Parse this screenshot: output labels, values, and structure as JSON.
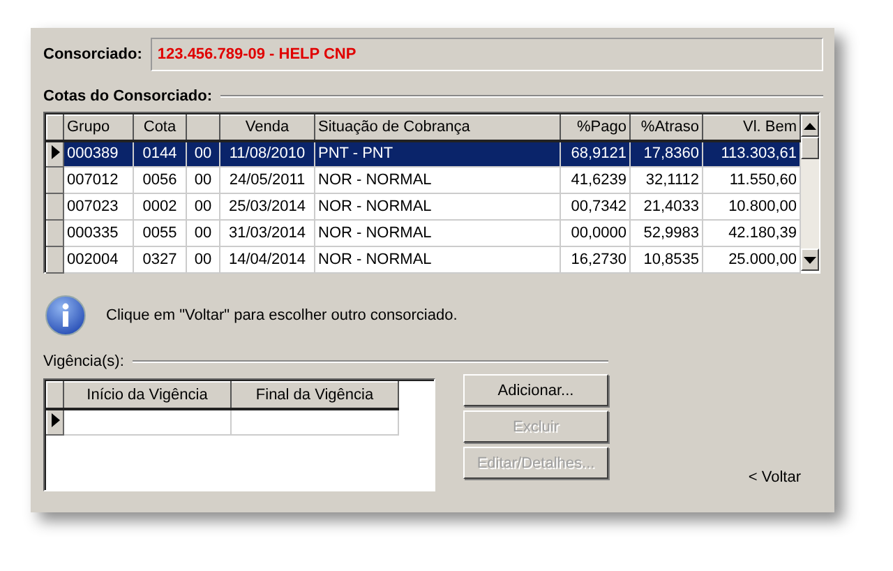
{
  "consorciado": {
    "label": "Consorciado:",
    "value": "123.456.789-09 - HELP CNP"
  },
  "cotas": {
    "title": "Cotas do Consorciado:",
    "columns": [
      {
        "kind": "text",
        "label": "Grupo"
      },
      {
        "kind": "text",
        "label": "Cota"
      },
      {
        "kind": "blank"
      },
      {
        "kind": "text",
        "label": "Venda"
      },
      {
        "kind": "text",
        "label": "Situação de Cobrança"
      },
      {
        "kind": "text",
        "label": "%Pago"
      },
      {
        "kind": "text",
        "label": "%Atraso"
      },
      {
        "kind": "text",
        "label": "Vl. Bem"
      }
    ],
    "rows": [
      {
        "selected": true,
        "cells": [
          "000389",
          "0144",
          "00",
          "11/08/2010",
          "PNT - PNT",
          "68,9121",
          "17,8360",
          "113.303,61"
        ]
      },
      {
        "selected": false,
        "cells": [
          "007012",
          "0056",
          "00",
          "24/05/2011",
          "NOR - NORMAL",
          "41,6239",
          "32,1112",
          "11.550,60"
        ]
      },
      {
        "selected": false,
        "cells": [
          "007023",
          "0002",
          "00",
          "25/03/2014",
          "NOR - NORMAL",
          "00,7342",
          "21,4033",
          "10.800,00"
        ]
      },
      {
        "selected": false,
        "cells": [
          "000335",
          "0055",
          "00",
          "31/03/2014",
          "NOR - NORMAL",
          "00,0000",
          "52,9983",
          "42.180,39"
        ]
      },
      {
        "selected": false,
        "cells": [
          "002004",
          "0327",
          "00",
          "14/04/2014",
          "NOR - NORMAL",
          "16,2730",
          "10,8535",
          "25.000,00"
        ]
      }
    ]
  },
  "info": "Clique em \"Voltar\" para escolher outro consorciado.",
  "vigencias": {
    "title": "Vigência(s):",
    "columns": [
      "Início da Vigência",
      "Final da Vigência"
    ]
  },
  "buttons": [
    {
      "label": "Adicionar...",
      "disabled": false
    },
    {
      "label": "Excluir",
      "disabled": true
    },
    {
      "label": "Editar/Detalhes...",
      "disabled": true
    }
  ],
  "back": "< Voltar"
}
